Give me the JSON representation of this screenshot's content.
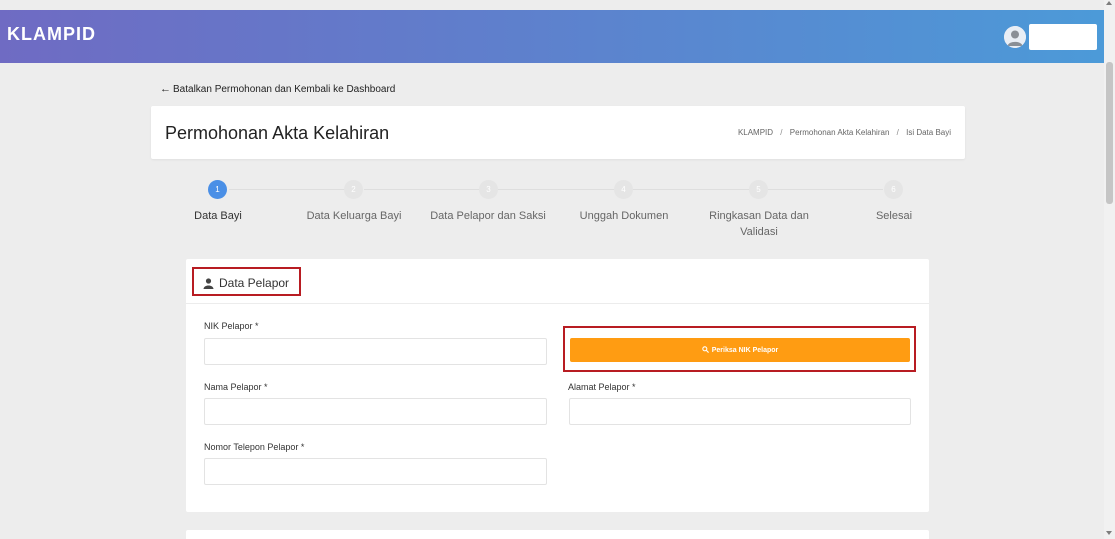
{
  "app": {
    "brand": "KLAMPID"
  },
  "nav": {
    "back_link": "Batalkan Permohonan dan Kembali ke Dashboard"
  },
  "header": {
    "title": "Permohonan Akta Kelahiran",
    "breadcrumb": [
      "KLAMPID",
      "Permohonan Akta Kelahiran",
      "Isi Data Bayi"
    ],
    "breadcrumb_separator": "/"
  },
  "stepper": {
    "active_step": 1,
    "steps": [
      {
        "number": "1",
        "label": "Data Bayi"
      },
      {
        "number": "2",
        "label": "Data Keluarga Bayi"
      },
      {
        "number": "3",
        "label": "Data Pelapor dan Saksi"
      },
      {
        "number": "4",
        "label": "Unggah Dokumen"
      },
      {
        "number": "5",
        "label": "Ringkasan Data dan",
        "label_line2": "Validasi"
      },
      {
        "number": "6",
        "label": "Selesai"
      }
    ]
  },
  "form": {
    "section_title": "Data Pelapor",
    "nik_label": "NIK Pelapor *",
    "nik_value": "",
    "check_button": "Periksa NIK Pelapor",
    "name_label": "Nama Pelapor *",
    "name_value": "",
    "address_label": "Alamat Pelapor *",
    "address_value": "",
    "phone_label": "Nomor Telepon Pelapor *",
    "phone_value": ""
  },
  "colors": {
    "accent": "#ff9c12",
    "active_step": "#4a8fe6",
    "highlight_border": "#b81c22",
    "topbar_start": "#6f6bc3",
    "topbar_end": "#4c9ad8"
  },
  "icons": {
    "back": "arrow-left-icon",
    "user": "user-icon",
    "search": "search-icon",
    "avatar": "avatar-icon"
  }
}
